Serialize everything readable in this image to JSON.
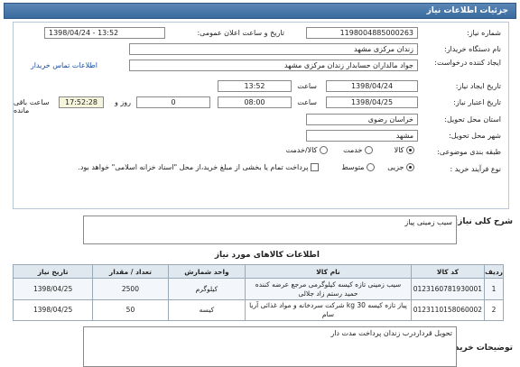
{
  "header": {
    "title": "جزئیات اطلاعات نیاز"
  },
  "form": {
    "need_number_label": "شماره نیاز:",
    "need_number": "1198004885000263",
    "announce_label": "تاریخ و ساعت اعلان عمومی:",
    "announce_value": "1398/04/24 - 13:52",
    "buyer_org_label": "نام دستگاه خریدار:",
    "buyer_org": "زندان مرکزی مشهد",
    "creator_label": "ایجاد کننده درخواست:",
    "creator": "جواد مالداران حسابدار زندان مرکزی مشهد",
    "buyer_contact_link": "اطلاعات تماس خریدار",
    "created_date_label": "تاریخ ایجاد نیاز:",
    "created_date": "1398/04/24",
    "time_label": "ساعت",
    "created_time": "13:52",
    "deadline_label": "تاریخ اعتبار نیاز:",
    "deadline_date": "1398/04/25",
    "deadline_time": "08:00",
    "days_value": "0",
    "days_label": "روز و",
    "remaining_time": "17:52:28",
    "remaining_label": "ساعت باقی مانده",
    "province_label": "استان محل تحویل:",
    "province": "خراسان رضوی",
    "city_label": "شهر محل تحویل:",
    "city": "مشهد",
    "category_label": "طبقه بندی موضوعی:",
    "category_options": [
      "کالا",
      "خدمت",
      "کالا/خدمت"
    ],
    "process_label": "نوع فرآیند خرید :",
    "process_options": [
      "جزیی",
      "متوسط"
    ],
    "payment_note": "پرداخت تمام یا بخشی از مبلغ خرید،از محل \"اسناد خزانه اسلامی\" خواهد بود."
  },
  "general_desc": {
    "label": "شرح کلی نیاز:",
    "value": "سیب زمینی پیاز"
  },
  "items": {
    "title": "اطلاعات کالاهای مورد نیاز",
    "columns": [
      "ردیف",
      "کد کالا",
      "نام کالا",
      "واحد شمارش",
      "تعداد / مقدار",
      "تاریخ نیاز"
    ],
    "rows": [
      [
        "1",
        "0123160781930001",
        "سیب زمینی تازه کیسه کیلوگرمی مرجع عرضه کننده حمید رستم زاد جلالی",
        "کیلوگرم",
        "2500",
        "1398/04/25"
      ],
      [
        "2",
        "0123110158060002",
        "پیاز تازه کیسه 30 kg شرکت سردخانه و مواد غذائی آریا سام",
        "کیسه",
        "50",
        "1398/04/25"
      ]
    ]
  },
  "buyer_notes": {
    "label": "توضیحات خریدار:",
    "value": "تحویل قرداردرب زندان پرداخت مدت دار"
  }
}
